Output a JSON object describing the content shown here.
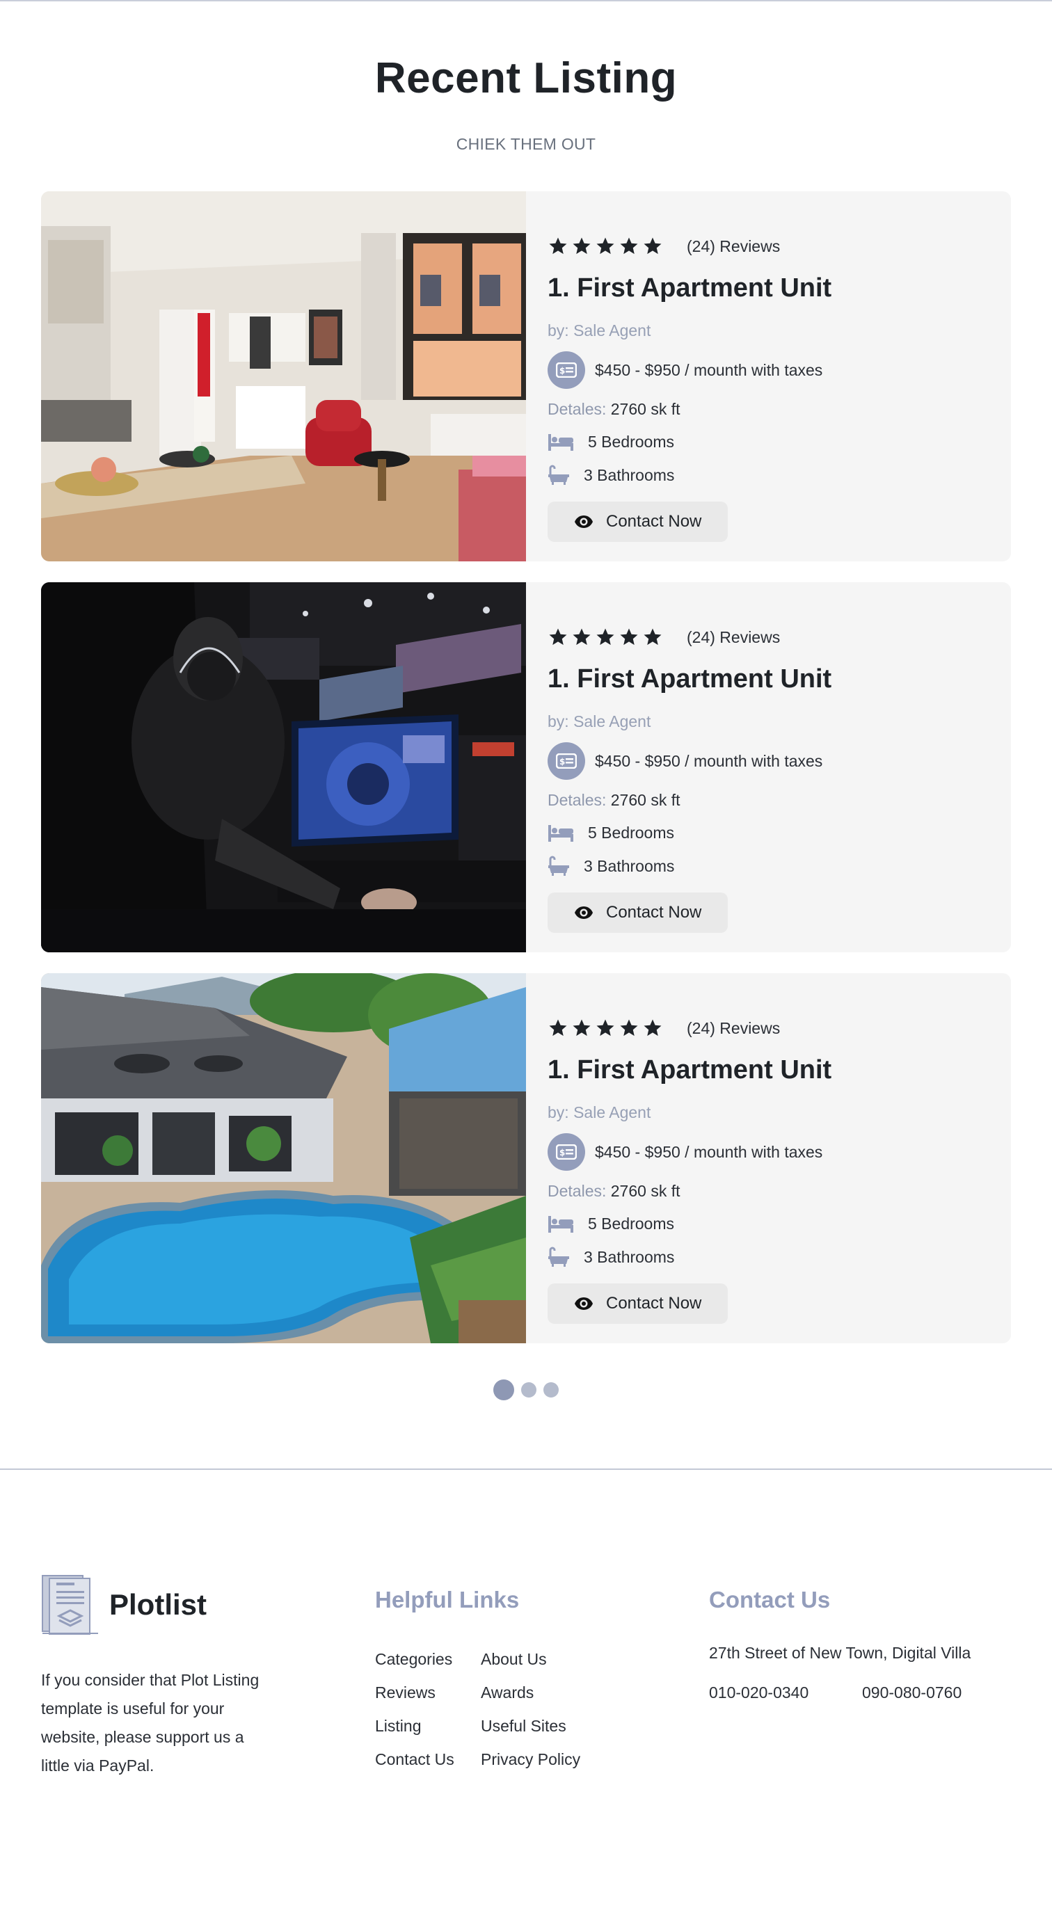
{
  "section": {
    "title": "Recent Listing",
    "subtitle": "CHIEK THEM OUT"
  },
  "listings": [
    {
      "reviews": "(24) Reviews",
      "stars": 5,
      "title": "1. First Apartment Unit",
      "by_prefix": "by:",
      "by_name": "Sale Agent",
      "price": "$450 - $950 / mounth with taxes",
      "details_label": "Detales:",
      "details_value": "2760 sk ft",
      "bedrooms": "5 Bedrooms",
      "bathrooms": "3 Bathrooms",
      "contact_label": "Contact Now",
      "photo": "apartment-interior"
    },
    {
      "reviews": "(24) Reviews",
      "stars": 5,
      "title": "1. First Apartment Unit",
      "by_prefix": "by:",
      "by_name": "Sale Agent",
      "price": "$450 - $950 / mounth with taxes",
      "details_label": "Detales:",
      "details_value": "2760 sk ft",
      "bedrooms": "5 Bedrooms",
      "bathrooms": "3 Bathrooms",
      "contact_label": "Contact Now",
      "photo": "gamer-at-monitor"
    },
    {
      "reviews": "(24) Reviews",
      "stars": 5,
      "title": "1. First Apartment Unit",
      "by_prefix": "by:",
      "by_name": "Sale Agent",
      "price": "$450 - $950 / mounth with taxes",
      "details_label": "Detales:",
      "details_value": "2760 sk ft",
      "bedrooms": "5 Bedrooms",
      "bathrooms": "3 Bathrooms",
      "contact_label": "Contact Now",
      "photo": "villa-with-pool"
    }
  ],
  "pager": {
    "count": 3,
    "active_index": 0
  },
  "footer": {
    "brand": "Plotlist",
    "blurb": "If you consider that Plot Listing template is useful for your website, please support us a little via PayPal.",
    "links_heading": "Helpful Links",
    "links": [
      "Categories",
      "About Us",
      "Reviews",
      "Awards",
      "Listing",
      "Useful Sites",
      "Contact Us",
      "Privacy Policy"
    ],
    "contact_heading": "Contact Us",
    "address": "27th Street of New Town, Digital Villa",
    "phone1": "010-020-0340",
    "phone2": "090-080-0760"
  },
  "icons": {
    "star": "star-icon",
    "price": "price-tag-icon",
    "bed": "bed-icon",
    "bath": "bathtub-icon",
    "eye": "eye-icon",
    "logo": "document-stack-logo-icon"
  },
  "colors": {
    "accent": "#939dbb",
    "card_bg": "#f5f5f5",
    "button_bg": "#e9e9e9",
    "text": "#1f2328"
  }
}
